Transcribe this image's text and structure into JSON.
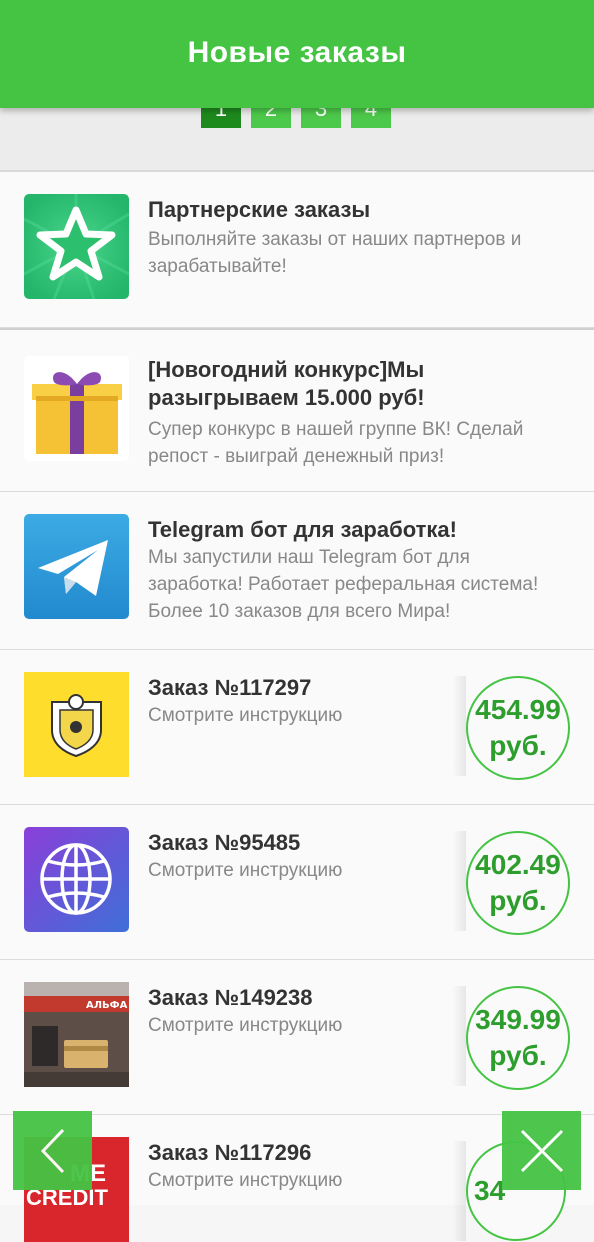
{
  "header": {
    "title": "Новые заказы"
  },
  "pager": {
    "pages": [
      "1",
      "2",
      "3",
      "4"
    ],
    "active_index": 0
  },
  "cards": [
    {
      "title": "Партнерские заказы",
      "desc": [
        "Выполняйте заказы от наших партнеров и",
        "зарабатывайте!"
      ],
      "icon": "star-icon"
    },
    {
      "title": "[Новогодний конкурс]Мы разыгрываем 15.000 руб!",
      "desc": [
        "Супер конкурс в нашей группе ВК! Сделай",
        "репост - выиграй денежный приз!"
      ],
      "icon": "gift-icon"
    },
    {
      "title": "Telegram бот для заработка!",
      "desc": [
        "Мы запустили наш Telegram бот для",
        "заработка! Работает реферальная система!",
        "Более 10 заказов для всего Мира!"
      ],
      "icon": "telegram-icon"
    },
    {
      "title": "Заказ №117297",
      "desc": [
        "Смотрите инструкцию"
      ],
      "price_value": "454.99",
      "price_unit": "руб.",
      "icon": "tinkoff-logo-icon"
    },
    {
      "title": "Заказ №95485",
      "desc": [
        "Смотрите инструкцию"
      ],
      "price_value": "402.49",
      "price_unit": "руб.",
      "icon": "globe-icon"
    },
    {
      "title": "Заказ №149238",
      "desc": [
        "Смотрите инструкцию"
      ],
      "price_value": "349.99",
      "price_unit": "руб.",
      "icon": "bank-photo-icon"
    },
    {
      "title": "Заказ №117296",
      "desc": [
        "Смотрите инструкцию"
      ],
      "price_value": "34",
      "price_unit": "",
      "icon": "home-credit-logo-icon"
    }
  ],
  "logo_text": {
    "home_credit": [
      "ME",
      "CREDIT"
    ],
    "bank_sign": "АЛЬФА"
  },
  "colors": {
    "accent": "#45c444",
    "accent_dark": "#2d9e2d",
    "price": "#2d9e2d"
  },
  "nav": {
    "back_icon": "chevron-left-icon",
    "close_icon": "close-icon"
  }
}
